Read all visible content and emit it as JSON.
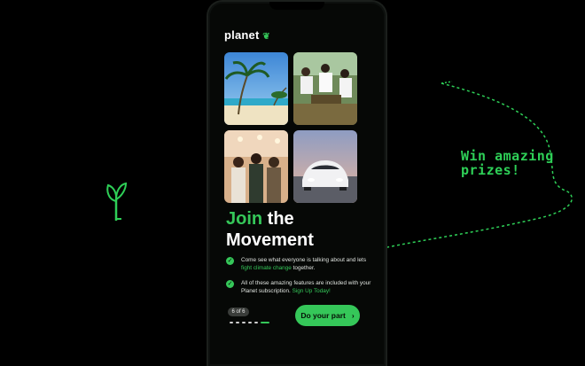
{
  "app": {
    "logo_text": "planet"
  },
  "hero": {
    "title_accent": "Join",
    "title_rest": " the",
    "title_line2": "Movement"
  },
  "bullets": [
    {
      "text": "Come see what everyone is talking about and lets ",
      "emphasis": "fight climate change",
      "after": " together."
    },
    {
      "text": "All of these amazing features are included with your Planet subscription. ",
      "emphasis": "Sign Up Today!",
      "after": ""
    }
  ],
  "pagination": {
    "label": "6 of 6",
    "dots": 6,
    "active_index": 5
  },
  "cta": {
    "label": "Do your part"
  },
  "side_caption": {
    "line1": "Win amazing",
    "line2": "prizes!"
  },
  "colors": {
    "accent": "#35c759",
    "background": "#000000",
    "phone_bg": "#060806"
  },
  "icons": [
    "sprout-icon",
    "check-icon",
    "chevron-right-icon",
    "leaf-icon"
  ]
}
